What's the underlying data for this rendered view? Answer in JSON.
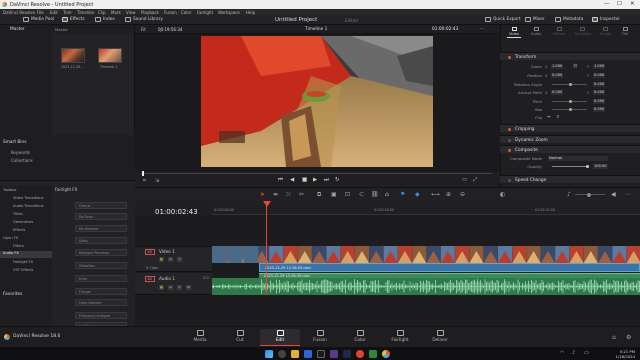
{
  "app": {
    "title": "DaVinci Resolve - Untitled Project",
    "window_controls": {
      "minimize": "—",
      "maximize": "☐",
      "close": "✕"
    }
  },
  "menu": [
    "DaVinci Resolve",
    "File",
    "Edit",
    "Trim",
    "Timeline",
    "Clip",
    "Mark",
    "View",
    "Playback",
    "Fusion",
    "Color",
    "Fairlight",
    "Workspace",
    "Help"
  ],
  "toolbar": {
    "media_pool": "Media Pool",
    "effects": "Effects",
    "index": "Index",
    "sound_library": "Sound Library",
    "project_title": "Untitled Project",
    "project_status": "Edited",
    "quick_export": "Quick Export",
    "mixer": "Mixer",
    "metadata": "Metadata",
    "inspector": "Inspector"
  },
  "media_pool": {
    "header": "Master",
    "panel_header": "Master",
    "clips": [
      {
        "label": "2023-12-29 ...",
        "kind": "video"
      },
      {
        "label": "Timeline 1",
        "kind": "timeline"
      }
    ],
    "smart_bins_header": "Smart Bins",
    "smart_bins": [
      "Keywords",
      "Collections"
    ]
  },
  "viewer": {
    "fit_label": "Fit",
    "source_timecode": "00:19:56:34",
    "timeline_name": "Timeline 1",
    "current_timecode": "01:00:02:43"
  },
  "inspector": {
    "tabs": [
      "Video",
      "Audio",
      "Effects",
      "Transition",
      "Image",
      "File"
    ],
    "transform": {
      "title": "Transform",
      "zoom_label": "Zoom",
      "zoom_x": "1.000",
      "zoom_y": "1.000",
      "position_label": "Position",
      "position_x": "0.000",
      "position_y": "0.000",
      "rotation_label": "Rotation Angle",
      "rotation": "0.000",
      "anchor_label": "Anchor Point",
      "anchor_x": "0.000",
      "anchor_y": "0.000",
      "pitch_label": "Pitch",
      "pitch": "0.000",
      "yaw_label": "Yaw",
      "yaw": "0.000",
      "flip_label": "Flip"
    },
    "cropping": "Cropping",
    "dynamic_zoom": "Dynamic Zoom",
    "composite": {
      "title": "Composite",
      "mode_label": "Composite Mode",
      "mode_value": "Normal",
      "opacity_label": "Opacity",
      "opacity_value": "100.00"
    },
    "speed_change": "Speed Change"
  },
  "effects": {
    "library_label": "Fairlight FX",
    "tree": [
      {
        "label": "Toolbox",
        "level": 0,
        "expanded": true
      },
      {
        "label": "Video Transitions",
        "level": 1
      },
      {
        "label": "Audio Transitions",
        "level": 1
      },
      {
        "label": "Titles",
        "level": 1
      },
      {
        "label": "Generators",
        "level": 1
      },
      {
        "label": "Effects",
        "level": 1
      },
      {
        "label": "Open FX",
        "level": 0,
        "expanded": true
      },
      {
        "label": "Filters",
        "level": 1
      },
      {
        "label": "Audio FX",
        "level": 0,
        "expanded": true,
        "selected": true
      },
      {
        "label": "Fairlight FX",
        "level": 1
      },
      {
        "label": "VST Effects",
        "level": 1
      }
    ],
    "favorites_header": "Favorites",
    "items": [
      "Chorus",
      "De-Esser",
      "De-Hummer",
      "Delay",
      "Dialogue Processor",
      "Distortion",
      "Echo",
      "Flanger",
      "Foley Sampler",
      "Frequency Analyzer",
      "Lip Filter"
    ]
  },
  "timeline": {
    "timecode": "01:00:02:43",
    "ruler_ticks": [
      "01:00:00:00",
      "01:00:16:00",
      "01:00:32:00"
    ],
    "video_track": {
      "badge": "V1",
      "name": "Video 1",
      "clip_count": "0 Clips"
    },
    "audio_track": {
      "badge": "A1",
      "name": "Audio 1",
      "level": "2.0"
    },
    "video_clip_name": "2023-12-29 13-36-59.mkv",
    "audio_clip_name": "2023-12-29 13-36-59.mkv"
  },
  "pages": [
    {
      "label": "Media",
      "active": false
    },
    {
      "label": "Cut",
      "active": false
    },
    {
      "label": "Edit",
      "active": true
    },
    {
      "label": "Fusion",
      "active": false
    },
    {
      "label": "Color",
      "active": false
    },
    {
      "label": "Fairlight",
      "active": false
    },
    {
      "label": "Deliver",
      "active": false
    }
  ],
  "footer": {
    "brand": "DaVinci Resolve 18.6"
  },
  "taskbar": {
    "time": "5:21 PM",
    "date": "1/18/2024"
  },
  "colors": {
    "accent": "#e8443a",
    "video_clip": "#3a75a8",
    "audio_clip": "#2f7a4b",
    "inspector_section_dot": "#e0583c"
  }
}
